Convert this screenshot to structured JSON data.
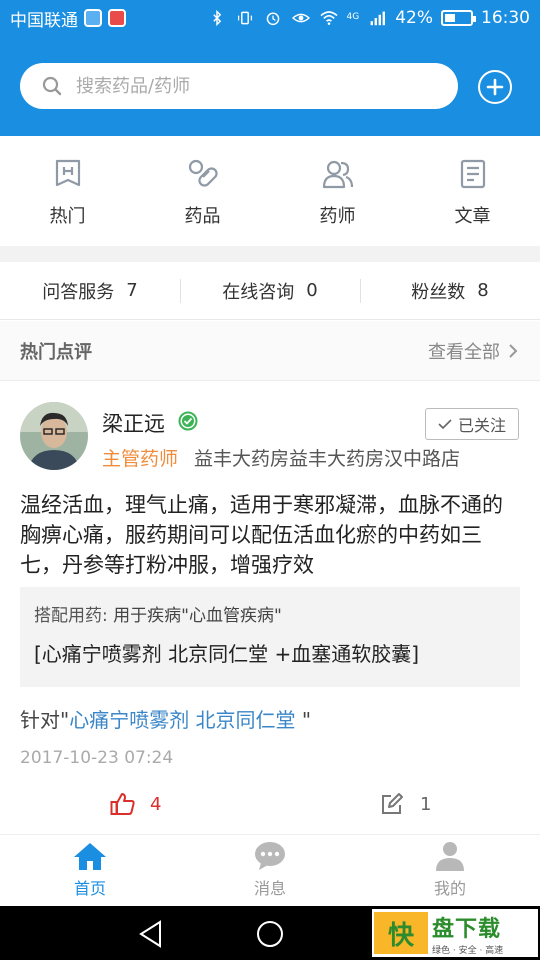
{
  "status_bar": {
    "carrier": "中国联通",
    "network": "4G",
    "battery_text": "42%",
    "battery_level": 0.42,
    "time": "16:30"
  },
  "search": {
    "placeholder": "搜索药品/药师"
  },
  "categories": [
    {
      "label": "热门",
      "icon": "bookmark-h-icon"
    },
    {
      "label": "药品",
      "icon": "pill-icon"
    },
    {
      "label": "药师",
      "icon": "people-icon"
    },
    {
      "label": "文章",
      "icon": "document-icon"
    }
  ],
  "stats": [
    {
      "label": "问答服务",
      "count": "7"
    },
    {
      "label": "在线咨询",
      "count": "0"
    },
    {
      "label": "粉丝数",
      "count": "8"
    }
  ],
  "section": {
    "title": "热门点评",
    "view_all": "查看全部"
  },
  "review": {
    "user_name": "梁正远",
    "role": "主管药师",
    "store": "益丰大药房益丰大药房汉中路店",
    "follow_label": "已关注",
    "text": "温经活血，理气止痛，适用于寒邪凝滞，血脉不通的胸痹心痛，服药期间可以配伍活血化瘀的中药如三七，丹参等打粉冲服，增强疗效",
    "combo_label": "搭配用药:",
    "combo_disease": "用于疾病\"心血管疾病\"",
    "combo_drugs": "[心痛宁喷雾剂 北京同仁堂 +血塞通软胶囊]",
    "target_prefix": "针对\"",
    "target_link": "心痛宁喷雾剂 北京同仁堂",
    "target_suffix": " \"",
    "time": "2017-10-23 07:24",
    "likes": "4",
    "comments": "1"
  },
  "tabs": [
    {
      "label": "首页",
      "active": true
    },
    {
      "label": "消息",
      "active": false
    },
    {
      "label": "我的",
      "active": false
    }
  ],
  "watermark": {
    "badge": "快",
    "title": "盘下载",
    "tagline": "绿色 · 安全 · 高速"
  },
  "colors": {
    "primary": "#1a8ee1",
    "role_orange": "#f08c3b",
    "like_red": "#d9302d",
    "link_blue": "#3a86c8"
  }
}
